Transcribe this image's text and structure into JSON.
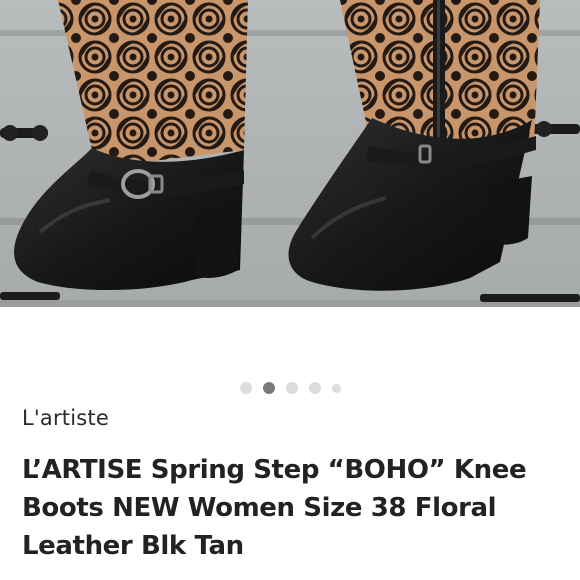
{
  "listing": {
    "brand": "L'artiste",
    "title": "L’ARTISE Spring Step “BOHO” Knee Boots NEW Women Size 38 Floral Leather Blk Tan"
  },
  "gallery": {
    "image_count": 5,
    "active_index": 1
  },
  "colors": {
    "accent": "#7a7a7a",
    "text": "#222222",
    "boot_leather": "#1d1d1d",
    "floral_tan": "#c9956a"
  }
}
